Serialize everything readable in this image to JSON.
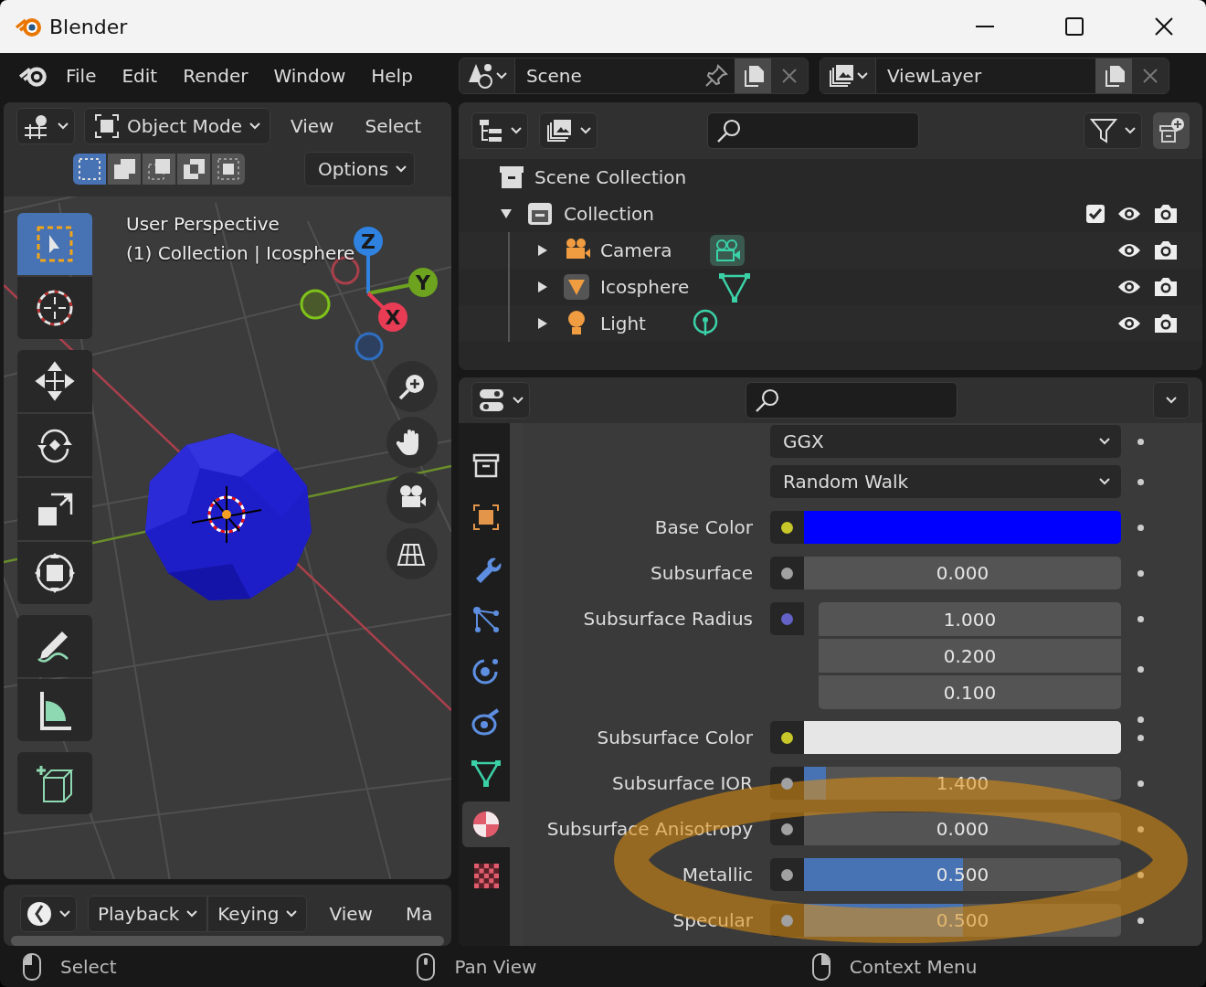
{
  "window": {
    "title": "Blender"
  },
  "menu_bar": {
    "items": [
      "File",
      "Edit",
      "Render",
      "Window",
      "Help"
    ]
  },
  "scene_selector": {
    "value": "Scene"
  },
  "view_layer_selector": {
    "value": "ViewLayer"
  },
  "viewport": {
    "mode": "Object Mode",
    "menus": [
      "View",
      "Select"
    ],
    "options_label": "Options",
    "select_modes": [
      {
        "kind": "set",
        "selected": true
      },
      {
        "kind": "extend",
        "selected": false
      },
      {
        "kind": "subtract",
        "selected": false
      },
      {
        "kind": "invert",
        "selected": false
      },
      {
        "kind": "intersect",
        "selected": false
      }
    ],
    "overlay_lines": [
      "User Perspective",
      "(1) Collection | Icosphere"
    ],
    "tool_groups": [
      {
        "tools": [
          {
            "kind": "select",
            "selected": true
          },
          {
            "kind": "cursor",
            "selected": false
          }
        ]
      },
      {
        "tools": [
          {
            "kind": "move",
            "selected": false
          },
          {
            "kind": "rotate",
            "selected": false
          },
          {
            "kind": "scale",
            "selected": false
          },
          {
            "kind": "transform",
            "selected": false
          }
        ]
      },
      {
        "tools": [
          {
            "kind": "annotate",
            "selected": false
          },
          {
            "kind": "measure",
            "selected": false
          }
        ]
      },
      {
        "tools": [
          {
            "kind": "add_cube",
            "selected": false
          }
        ]
      }
    ],
    "axis_labels": [
      "Z",
      "Y",
      "X"
    ],
    "nav_buttons": [
      {
        "kind": "zoom"
      },
      {
        "kind": "pan"
      },
      {
        "kind": "camera"
      },
      {
        "kind": "ortho"
      }
    ]
  },
  "timeline": {
    "menus": [
      "Playback",
      "Keying"
    ],
    "links": [
      "View",
      "Ma"
    ]
  },
  "outliner": {
    "root": "Scene Collection",
    "tree": [
      {
        "name": "Collection",
        "kind": "collection",
        "expanded": true,
        "checked": true,
        "visible": true,
        "children": [
          {
            "name": "Camera",
            "kind": "camera",
            "expanded": false,
            "visible": true
          },
          {
            "name": "Icosphere",
            "kind": "mesh",
            "expanded": false,
            "visible": true
          },
          {
            "name": "Light",
            "kind": "light",
            "expanded": false,
            "visible": true
          }
        ]
      }
    ]
  },
  "properties": {
    "tabs": [
      {
        "kind": "collection",
        "selected": false
      },
      {
        "kind": "object",
        "selected": false
      },
      {
        "kind": "modifiers",
        "selected": false
      },
      {
        "kind": "particles",
        "selected": false
      },
      {
        "kind": "physics",
        "selected": false
      },
      {
        "kind": "constraints",
        "selected": false
      },
      {
        "kind": "data",
        "selected": false
      },
      {
        "kind": "material",
        "selected": true
      },
      {
        "kind": "texture",
        "selected": false
      }
    ],
    "rows": [
      {
        "kind": "dropdown",
        "value": "GGX"
      },
      {
        "kind": "dropdown",
        "value": "Random Walk"
      },
      {
        "kind": "color",
        "label": "Base Color",
        "socket": {
          "color": "#c7c729"
        },
        "color": "#0000ff"
      },
      {
        "kind": "slider",
        "label": "Subsurface",
        "socket": {
          "color": "#a1a1a1"
        },
        "value": "0.000",
        "level": 0
      },
      {
        "kind": "vector",
        "label": "Subsurface Radius",
        "socket": {
          "color": "#6363c7"
        },
        "values": [
          "1.000",
          "0.200",
          "0.100"
        ]
      },
      {
        "kind": "color",
        "label": "Subsurface Color",
        "socket": {
          "color": "#c7c729"
        },
        "color": "#e6e6e6"
      },
      {
        "kind": "slider",
        "label": "Subsurface IOR",
        "socket": {
          "color": "#a1a1a1"
        },
        "value": "1.400",
        "level": 0.07
      },
      {
        "kind": "slider",
        "label": "Subsurface Anisotropy",
        "socket": {
          "color": "#a1a1a1"
        },
        "value": "0.000",
        "level": 0
      },
      {
        "kind": "slider",
        "label": "Metallic",
        "socket": {
          "color": "#a1a1a1"
        },
        "value": "0.500",
        "level": 0.5
      },
      {
        "kind": "slider",
        "label": "Specular",
        "socket": {
          "color": "#a1a1a1"
        },
        "value": "0.500",
        "level": 0.5
      }
    ]
  },
  "status_bar": {
    "items": [
      "Select",
      "Pan View",
      "Context Menu"
    ]
  }
}
